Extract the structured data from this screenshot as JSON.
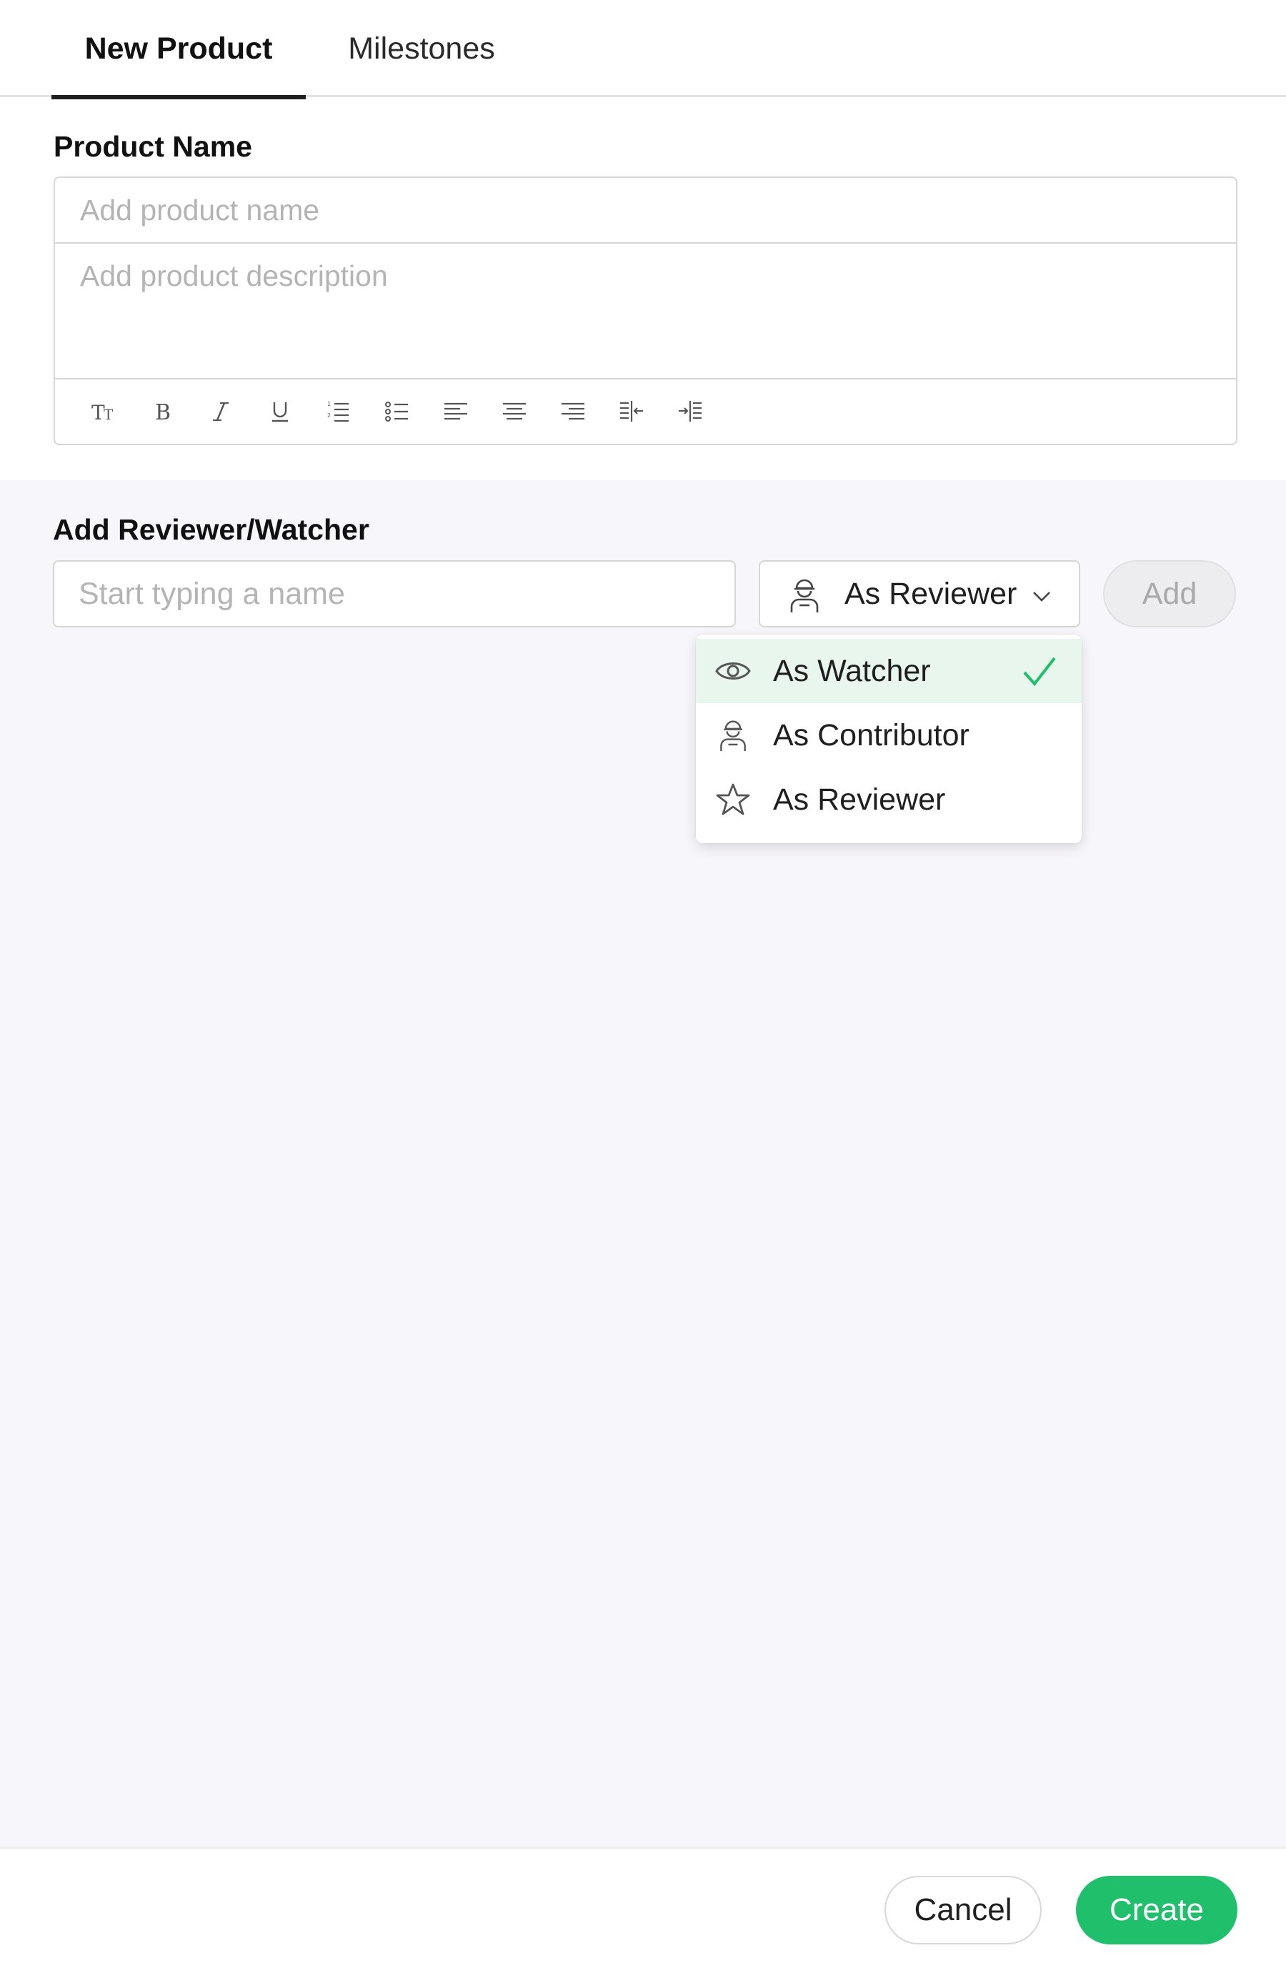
{
  "tabs": [
    {
      "label": "New Product",
      "active": true
    },
    {
      "label": "Milestones",
      "active": false
    }
  ],
  "product": {
    "section_label": "Product Name",
    "name_placeholder": "Add product name",
    "description_placeholder": "Add product description",
    "toolbar_icons": [
      "text-size-icon",
      "bold-icon",
      "italic-icon",
      "underline-icon",
      "ordered-list-icon",
      "bullet-list-icon",
      "align-left-icon",
      "align-center-icon",
      "align-right-icon",
      "outdent-icon",
      "indent-icon"
    ]
  },
  "reviewers": {
    "section_label": "Add Reviewer/Watcher",
    "search_placeholder": "Start typing a name",
    "role_selected": "As Reviewer",
    "add_label": "Add"
  },
  "dropdown": {
    "options": [
      {
        "label": "As Watcher",
        "icon": "eye-icon",
        "selected": true
      },
      {
        "label": "As Contributor",
        "icon": "person-icon",
        "selected": false
      },
      {
        "label": "As Reviewer",
        "icon": "star-icon",
        "selected": false
      }
    ]
  },
  "footer": {
    "cancel_label": "Cancel",
    "create_label": "Create"
  },
  "colors": {
    "accent": "#1fbf6b",
    "selected_row": "#e8f6ee",
    "panel_background": "#f7f6fa"
  }
}
